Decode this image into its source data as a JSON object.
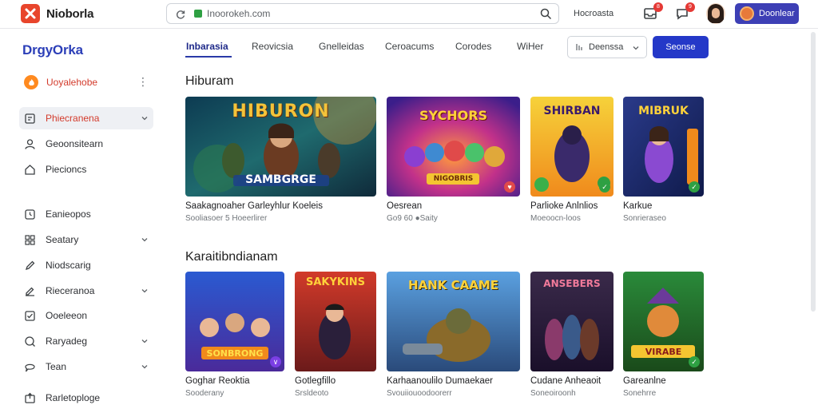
{
  "header": {
    "brand_name": "Nioborla",
    "url": "Inoorokeh.com",
    "link_label": "Hocroasta",
    "notif_count_1": "8",
    "notif_count_2": "9",
    "account_label": "Doonlear"
  },
  "sidebar": {
    "brand": "DrgyOrka",
    "items": [
      {
        "label": "Uoyalehobe",
        "icon": "flame-icon"
      },
      {
        "label": "Phiecranena",
        "icon": "document-icon"
      },
      {
        "label": "Geoonsitearn",
        "icon": "person-icon"
      },
      {
        "label": "Piecioncs",
        "icon": "home-icon"
      },
      {
        "label": "Eanieopos",
        "icon": "clock-icon"
      },
      {
        "label": "Seatary",
        "icon": "grid-icon"
      },
      {
        "label": "Niodscarig",
        "icon": "pen-icon"
      },
      {
        "label": "Rieceranoa",
        "icon": "edit-icon"
      },
      {
        "label": "Ooeleeon",
        "icon": "check-icon"
      },
      {
        "label": "Raryadeg",
        "icon": "help-icon"
      },
      {
        "label": "Tean",
        "icon": "chat-icon"
      },
      {
        "label": "Rarletoploge",
        "icon": "export-icon"
      }
    ]
  },
  "tabs": [
    "Inbarasia",
    "Reovicsia",
    "Gnelleidas",
    "Ceroacums",
    "Corodes",
    "WiHer"
  ],
  "dropdown": {
    "label": "Deenssa"
  },
  "primary_button": "Seonse",
  "sections": [
    {
      "title": "Hiburam",
      "cards": [
        {
          "title": "Saakagnoaher Garleyhlur Koeleis",
          "subtitle": "Sooliasoer 5 Hoeerlirer",
          "thumb_text": "HIBURON",
          "thumb_text2": "SAMBGRGE"
        },
        {
          "title": "Oesrean",
          "subtitle": "Go9 60 ●Saity",
          "thumb_text": "SYCHORS",
          "thumb_text2": "NIGOBRIS"
        },
        {
          "title": "Parlioke Anlnlios",
          "subtitle": "Moeoocn-loos",
          "thumb_text": "SHIRBAN",
          "thumb_text2": ""
        },
        {
          "title": "Karkue",
          "subtitle": "Sonrieraseo",
          "thumb_text": "MIBRUK",
          "thumb_text2": ""
        }
      ]
    },
    {
      "title": "Karaitibndianam",
      "cards": [
        {
          "title": "Goghar Reoktia",
          "subtitle": "Sooderany",
          "thumb_text": "SONBRONG",
          "thumb_text2": ""
        },
        {
          "title": "Gotlegfillo",
          "subtitle": "Srsldeoto",
          "thumb_text": "SAKYKINS",
          "thumb_text2": ""
        },
        {
          "title": "Karhaanoulilo Dumaekaer",
          "subtitle": "Svouiiouoodoorerr",
          "thumb_text": "HANK CAAME",
          "thumb_text2": ""
        },
        {
          "title": "Cudane Anheaoit",
          "subtitle": "Soneoiroonh",
          "thumb_text": "ANSEBERS",
          "thumb_text2": ""
        },
        {
          "title": "Gareanlne",
          "subtitle": "Sonehrre",
          "thumb_text": "VIRABE",
          "thumb_text2": ""
        }
      ]
    }
  ],
  "colors": {
    "accent": "#2438c8",
    "brand_red": "#e8452c",
    "active_tab": "#1f2a8a"
  }
}
